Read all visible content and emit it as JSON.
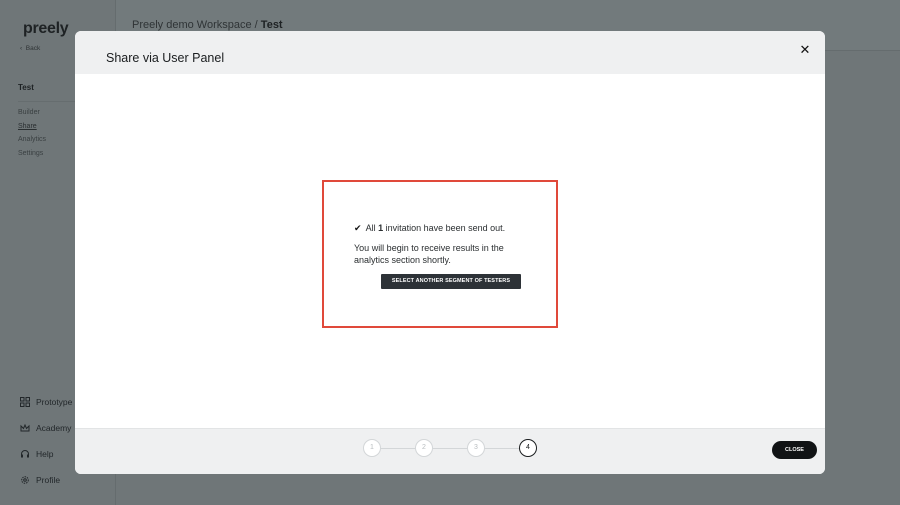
{
  "app": {
    "logo": "preely",
    "back_label": "Back",
    "project_name": "Test",
    "nav": [
      "Builder",
      "Share",
      "Analytics",
      "Settings"
    ],
    "bottom_nav": [
      {
        "label": "Prototype",
        "icon": "grid-icon"
      },
      {
        "label": "Academy",
        "icon": "crown-icon"
      },
      {
        "label": "Help",
        "icon": "headset-icon"
      },
      {
        "label": "Profile",
        "icon": "gear-icon"
      }
    ],
    "breadcrumb": {
      "workspace": "Preely demo Workspace",
      "separator": " / ",
      "current": "Test"
    }
  },
  "modal": {
    "title": "Share via User Panel",
    "close_icon": "close-icon",
    "message": {
      "check": "✔",
      "prefix": "All ",
      "count": "1",
      "suffix": " invitation have been send out.",
      "detail": "You will begin to receive results in the analytics section shortly."
    },
    "segment_button_label": "SELECT ANOTHER SEGMENT OF TESTERS",
    "steps": [
      "1",
      "2",
      "3",
      "4"
    ],
    "current_step": "4",
    "close_button_label": "CLOSE",
    "highlight_color": "#e0493a"
  }
}
